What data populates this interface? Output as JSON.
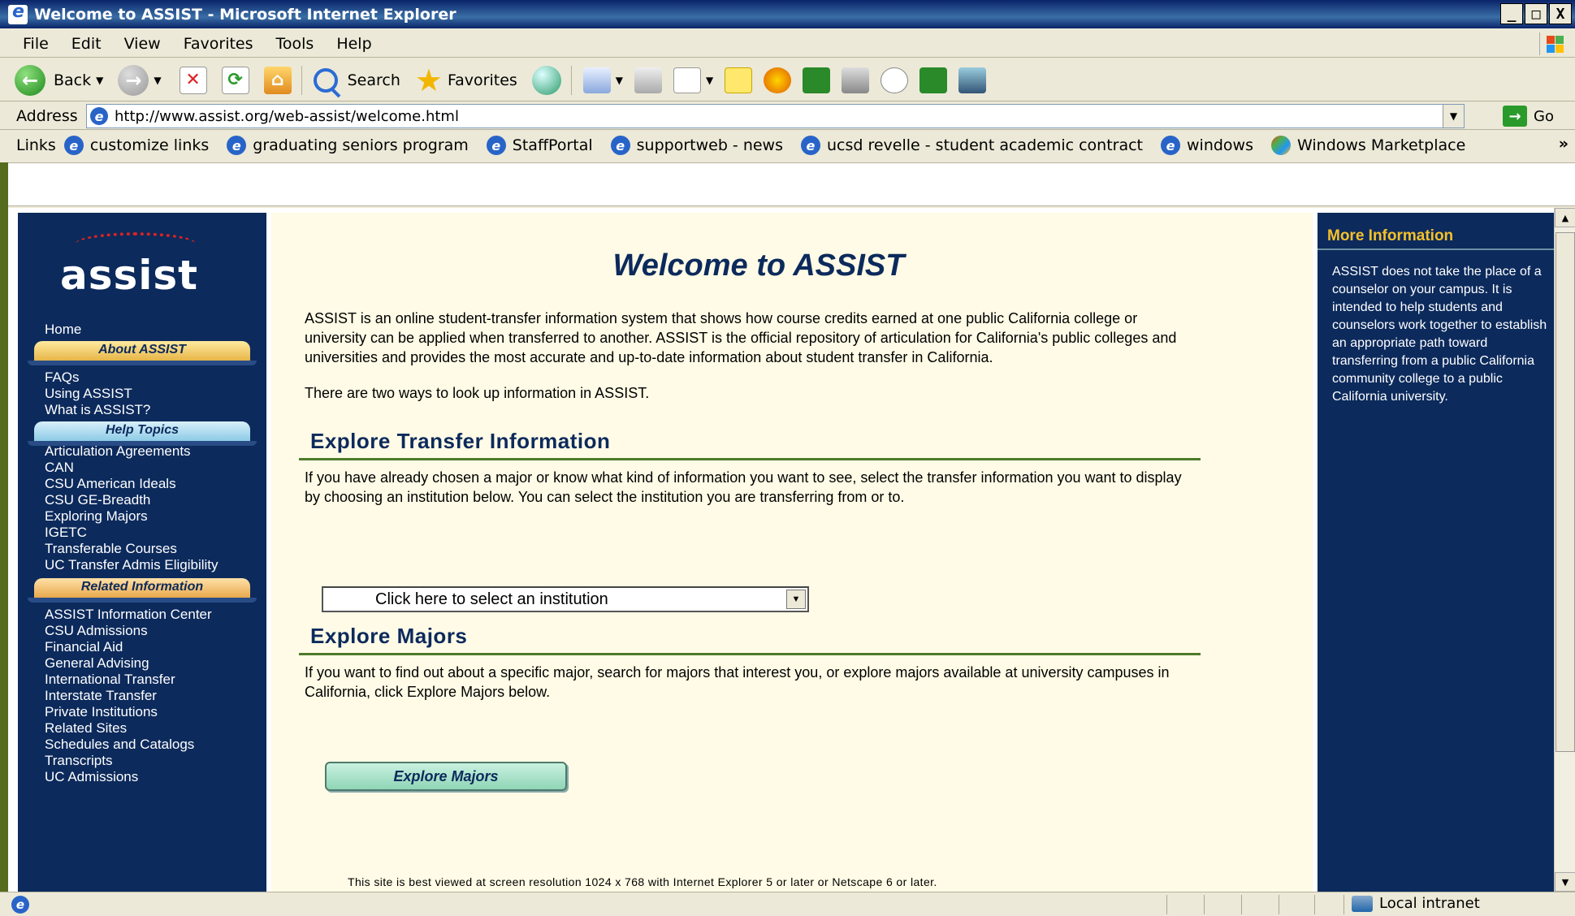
{
  "window": {
    "title": "Welcome to ASSIST - Microsoft Internet Explorer",
    "controls": [
      "_",
      "□",
      "X"
    ]
  },
  "menu": [
    "File",
    "Edit",
    "View",
    "Favorites",
    "Tools",
    "Help"
  ],
  "toolbar": {
    "back": "Back",
    "search": "Search",
    "favorites": "Favorites"
  },
  "address": {
    "label": "Address",
    "url": "http://www.assist.org/web-assist/welcome.html",
    "go": "Go"
  },
  "links": {
    "label": "Links",
    "items": [
      "customize links",
      "graduating seniors program",
      "StaffPortal",
      "supportweb - news",
      "ucsd revelle - student academic contract",
      "windows",
      "Windows Marketplace"
    ],
    "more": "»"
  },
  "nav": {
    "logo": "assist",
    "home": "Home",
    "sections": [
      {
        "header": "About ASSIST",
        "items": [
          "FAQs",
          "Using ASSIST",
          "What is ASSIST?"
        ]
      },
      {
        "header": "Help Topics",
        "items": [
          "Articulation Agreements",
          "CAN",
          "CSU American Ideals",
          "CSU GE-Breadth",
          "Exploring Majors",
          "IGETC",
          "Transferable Courses",
          "UC Transfer Admis Eligibility"
        ]
      },
      {
        "header": "Related Information",
        "items": [
          "ASSIST Information Center",
          "CSU Admissions",
          "Financial Aid",
          "General Advising",
          "International Transfer",
          "Interstate Transfer",
          "Private Institutions",
          "Related Sites",
          "Schedules and Catalogs",
          "Transcripts",
          "UC Admissions"
        ]
      }
    ]
  },
  "main": {
    "title": "Welcome to ASSIST",
    "intro": "ASSIST is an online student-transfer information system that shows how course credits earned at one public California college or university can be applied when transferred to another. ASSIST is the official repository of articulation for California's public colleges and universities and provides the most accurate and up-to-date information about student transfer in California.",
    "two_ways": "There are two ways to look up information in ASSIST.",
    "explore_transfer": {
      "heading": "Explore Transfer Information",
      "text": "If you have already chosen a major or know what kind of information you want to see, select the transfer information you want to display by choosing an institution below. You can select the institution you are transferring from or to.",
      "select_value": "Click here to select an institution"
    },
    "explore_majors": {
      "heading": "Explore Majors",
      "text": "If you want to find out about a specific major, search for majors that interest you, or explore majors available at university campuses in California, click Explore Majors below.",
      "button": "Explore Majors"
    },
    "footnote": "This site is best viewed at screen resolution 1024 x 768 with Internet Explorer 5 or later or Netscape 6 or later."
  },
  "right": {
    "heading": "More Information",
    "text": "ASSIST does not take the place of a counselor on your campus. It is intended to help students and counselors work together to establish an appropriate path toward transferring from a public California community college to a public California university."
  },
  "status": {
    "zone": "Local intranet"
  }
}
